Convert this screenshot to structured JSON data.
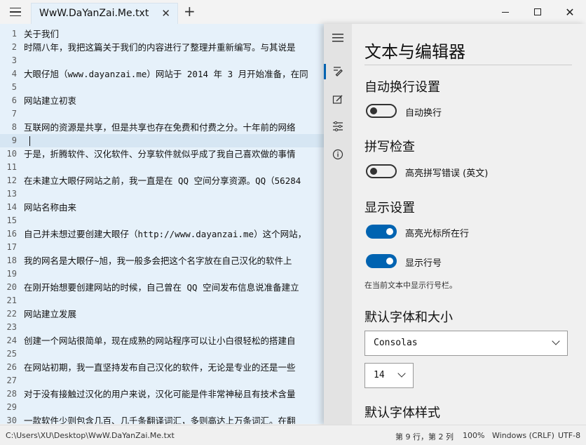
{
  "tab": {
    "title": "WwW.DaYanZai.Me.txt",
    "close": "✕",
    "new": "+"
  },
  "window": {
    "close": "✕"
  },
  "editor": {
    "lines": [
      {
        "num": "1",
        "text": "关于我们"
      },
      {
        "num": "2",
        "text": "时隔八年，我把这篇关于我们的内容进行了整理并重新编写。与其说是"
      },
      {
        "num": "3",
        "text": ""
      },
      {
        "num": "4",
        "text": "大眼仔旭（www.dayanzai.me）网站于 2014 年 3 月开始准备，在同"
      },
      {
        "num": "5",
        "text": ""
      },
      {
        "num": "6",
        "text": "网站建立初衷"
      },
      {
        "num": "7",
        "text": ""
      },
      {
        "num": "8",
        "text": "互联网的资源是共享，但是共享也存在免费和付费之分。十年前的网络"
      },
      {
        "num": "9",
        "text": ""
      },
      {
        "num": "10",
        "text": "于是，折腾软件、汉化软件、分享软件就似乎成了我自己喜欢做的事情"
      },
      {
        "num": "11",
        "text": ""
      },
      {
        "num": "12",
        "text": "在未建立大眼仔网站之前，我一直是在 QQ 空间分享资源。QQ（56284"
      },
      {
        "num": "13",
        "text": ""
      },
      {
        "num": "14",
        "text": "网站名称由来"
      },
      {
        "num": "15",
        "text": ""
      },
      {
        "num": "16",
        "text": "自己并未想过要创建大眼仔（http://www.dayanzai.me）这个网站，"
      },
      {
        "num": "17",
        "text": ""
      },
      {
        "num": "18",
        "text": "我的网名是大眼仔~旭，我一般多会把这个名字放在自己汉化的软件上"
      },
      {
        "num": "19",
        "text": ""
      },
      {
        "num": "20",
        "text": "在刚开始想要创建网站的时候，自己曾在 QQ 空间发布信息说准备建立"
      },
      {
        "num": "21",
        "text": ""
      },
      {
        "num": "22",
        "text": "网站建立发展"
      },
      {
        "num": "23",
        "text": ""
      },
      {
        "num": "24",
        "text": "创建一个网站很简单，现在成熟的网站程序可以让小白很轻松的搭建自"
      },
      {
        "num": "25",
        "text": ""
      },
      {
        "num": "26",
        "text": "在网站初期，我一直坚持发布自己汉化的软件，无论是专业的还是一些"
      },
      {
        "num": "27",
        "text": ""
      },
      {
        "num": "28",
        "text": "对于没有接触过汉化的用户来说，汉化可能是件非常神秘且有技术含量"
      },
      {
        "num": "29",
        "text": ""
      },
      {
        "num": "30",
        "text": "一款软件少则包含几百、几千条翻译词汇，多则高达上万条词汇。在翻"
      }
    ]
  },
  "settings": {
    "title": "文本与编辑器",
    "wrap": {
      "heading": "自动换行设置",
      "toggle_label": "自动换行",
      "state": "off"
    },
    "spell": {
      "heading": "拼写检查",
      "toggle_label": "高亮拼写错误 (英文)",
      "state": "off"
    },
    "display": {
      "heading": "显示设置",
      "highlight_label": "高亮光标所在行",
      "linenum_label": "显示行号",
      "hint": "在当前文本中显示行号栏。"
    },
    "font": {
      "heading": "默认字体和大小",
      "family": "Consolas",
      "size": "14"
    },
    "font_style": {
      "heading": "默认字体样式"
    }
  },
  "status": {
    "path": "C:\\Users\\XU\\Desktop\\WwW.DaYanZai.Me.txt",
    "position": "第 9 行，第 2 列",
    "zoom": "100%",
    "eol": "Windows (CRLF)",
    "encoding": "UTF-8"
  }
}
